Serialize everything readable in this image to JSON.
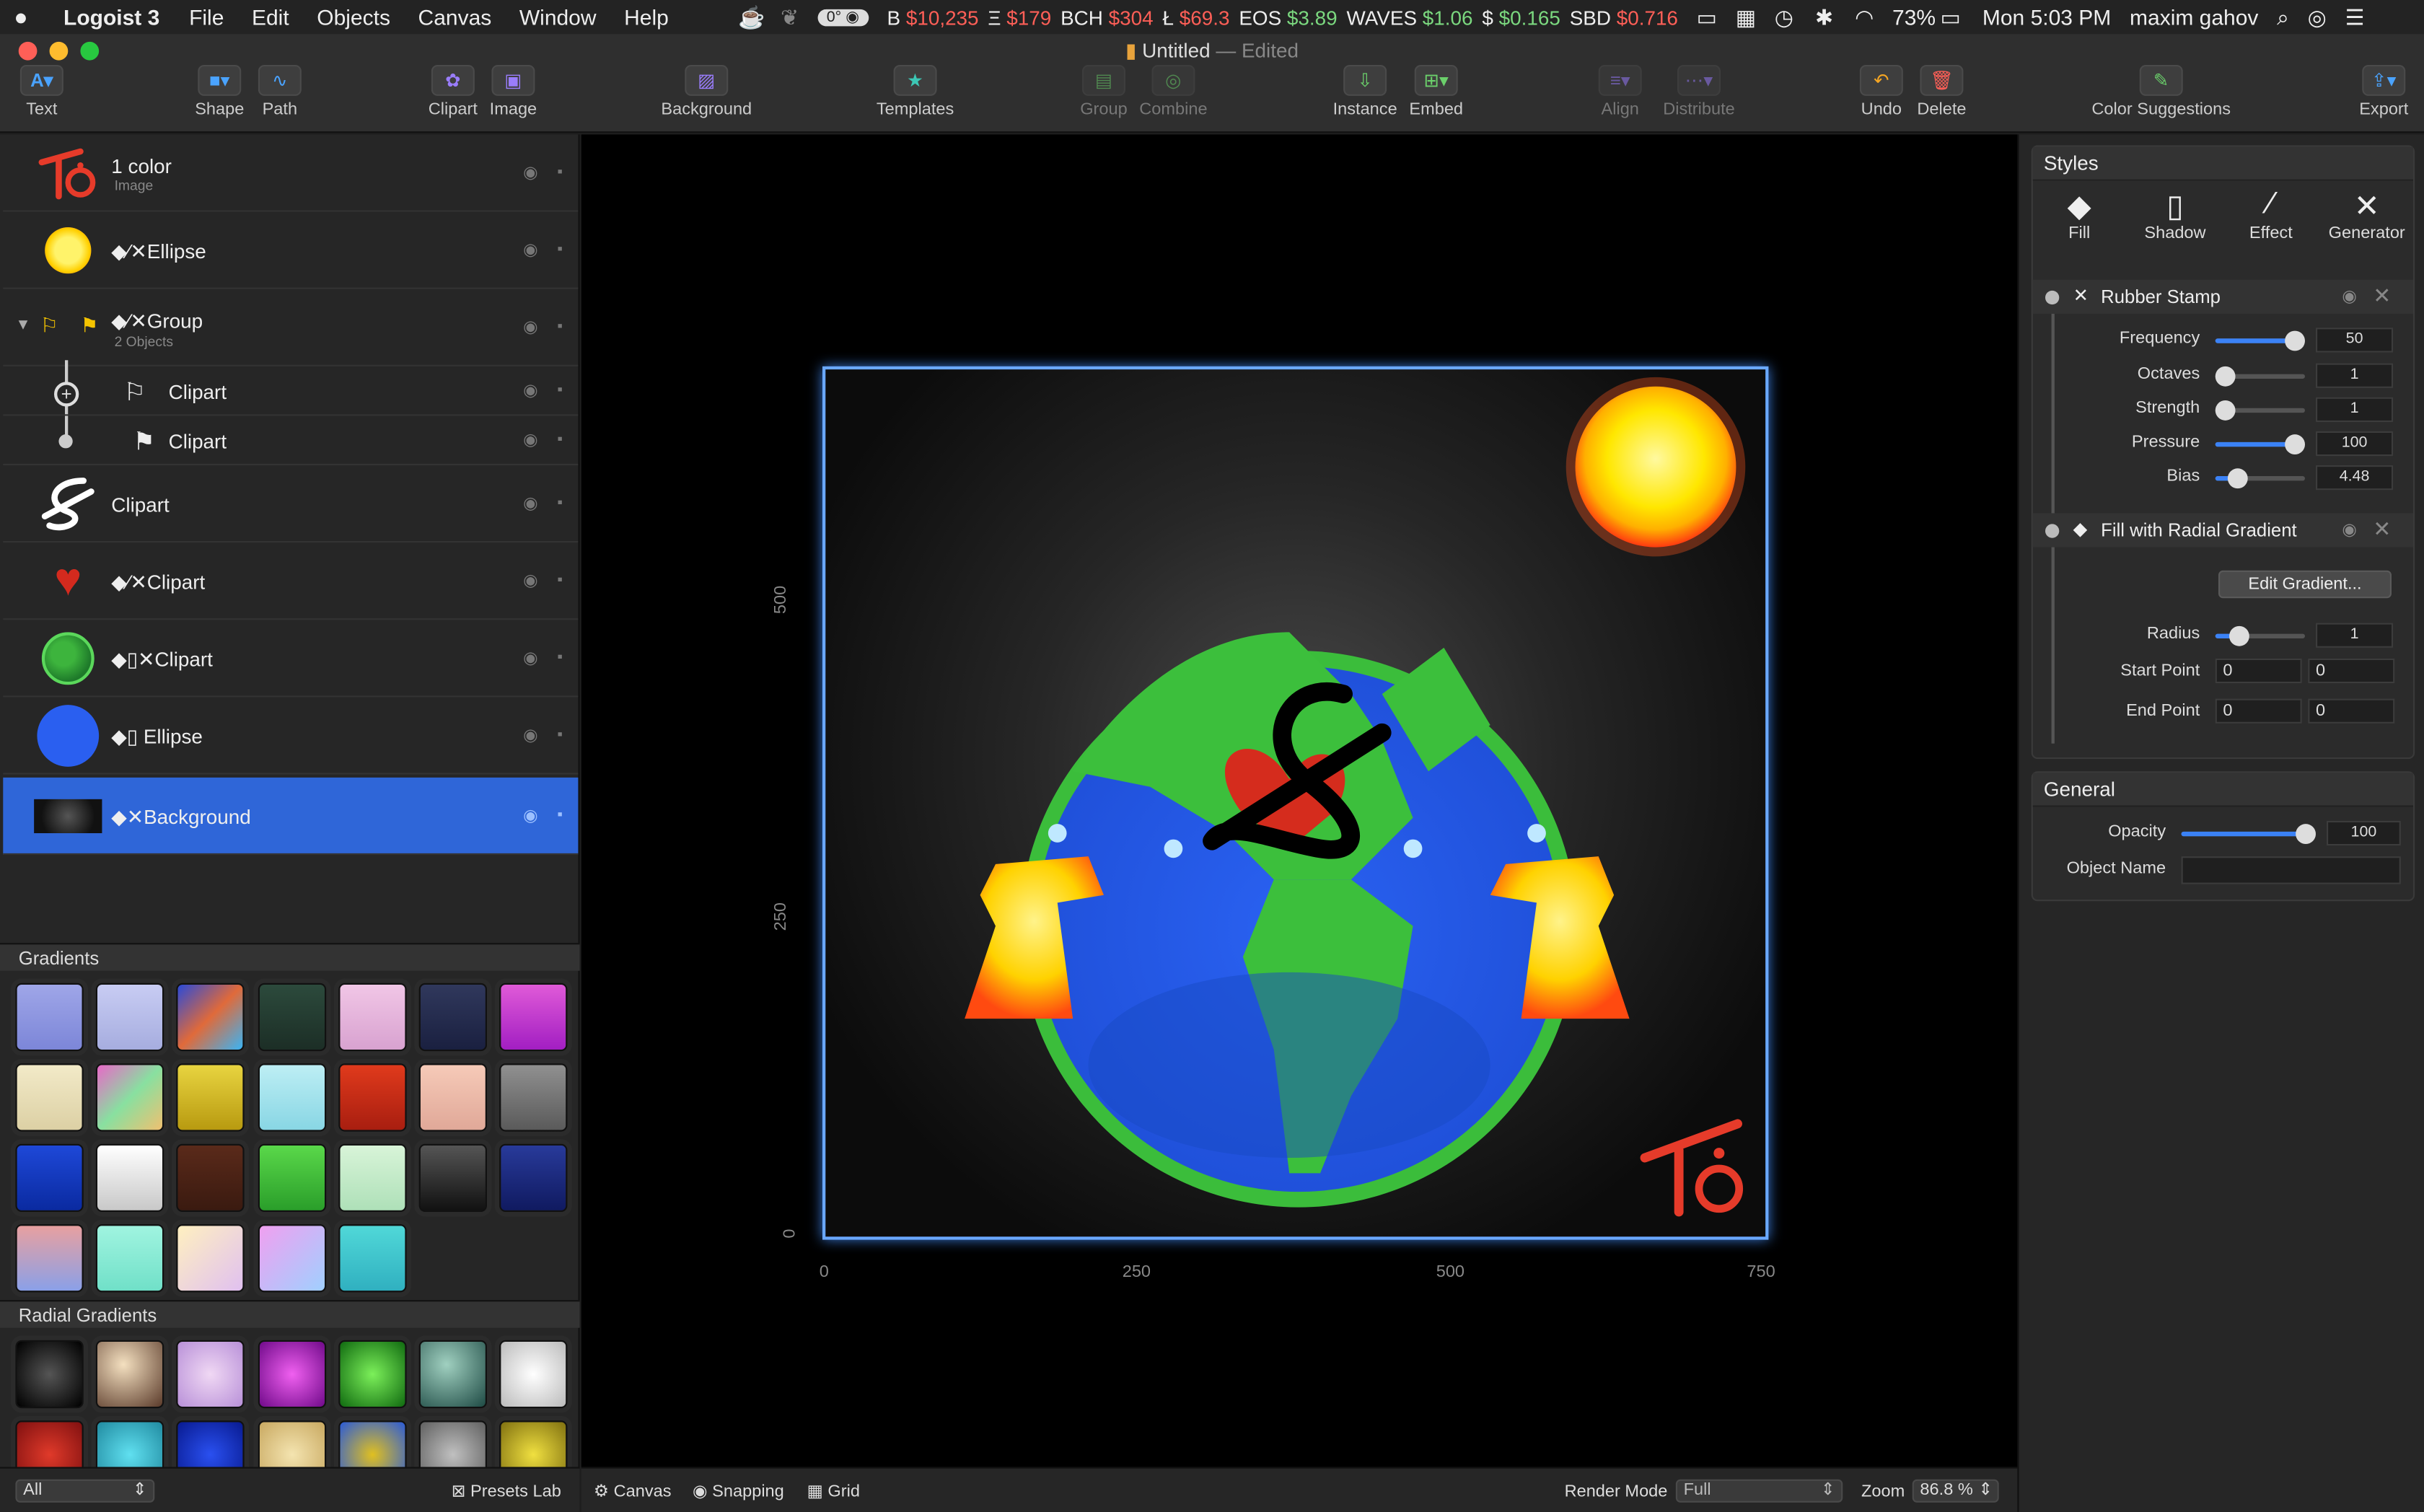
{
  "menubar": {
    "app": "Logoist 3",
    "menus": [
      "File",
      "Edit",
      "Objects",
      "Canvas",
      "Window",
      "Help"
    ],
    "temp": "0°",
    "tickers": [
      {
        "label": "B",
        "value": "$10,235",
        "c": "red"
      },
      {
        "label": "Ξ",
        "value": "$179",
        "c": "red"
      },
      {
        "label": "BCH",
        "value": "$304",
        "c": "red"
      },
      {
        "label": "Ł",
        "value": "$69.3",
        "c": "red"
      },
      {
        "label": "EOS",
        "value": "$3.89",
        "c": "grn"
      },
      {
        "label": "WAVES",
        "value": "$1.06",
        "c": "grn"
      },
      {
        "label": "$",
        "value": "$0.165",
        "c": "grn"
      },
      {
        "label": "SBD",
        "value": "$0.716",
        "c": "red"
      }
    ],
    "battery": "73%",
    "clock": "Mon 5:03 PM",
    "user": "maxim gahov"
  },
  "window": {
    "title": "Untitled",
    "edited": "— Edited"
  },
  "toolbar": {
    "text": "Text",
    "shape": "Shape",
    "path": "Path",
    "clipart": "Clipart",
    "image": "Image",
    "background": "Background",
    "templates": "Templates",
    "group": "Group",
    "combine": "Combine",
    "instance": "Instance",
    "embed": "Embed",
    "align": "Align",
    "distribute": "Distribute",
    "undo": "Undo",
    "delete": "Delete",
    "color_suggestions": "Color Suggestions",
    "export": "Export"
  },
  "layers": [
    {
      "name": "1 color",
      "sub": "Image"
    },
    {
      "name": "Ellipse"
    },
    {
      "name": "Group",
      "sub": "2 Objects"
    },
    {
      "name": "Clipart"
    },
    {
      "name": "Clipart"
    },
    {
      "name": "Clipart"
    },
    {
      "name": "Clipart"
    },
    {
      "name": "Clipart"
    },
    {
      "name": "Ellipse"
    },
    {
      "name": "Background"
    }
  ],
  "gradients": {
    "title": "Gradients",
    "radial_title": "Radial Gradients"
  },
  "left_bottom": {
    "filter": "All",
    "presets": "Presets Lab"
  },
  "canvas": {
    "y_ticks": [
      "500",
      "250",
      "0"
    ],
    "x_ticks": [
      "0",
      "250",
      "500",
      "750"
    ],
    "logo_text": "Tö"
  },
  "bottombar": {
    "canvas": "Canvas",
    "snapping": "Snapping",
    "grid": "Grid",
    "render_label": "Render Mode",
    "render_value": "Full",
    "zoom_label": "Zoom",
    "zoom_value": "86.8 %"
  },
  "styles": {
    "title": "Styles",
    "tabs": [
      "Fill",
      "Shadow",
      "Effect",
      "Generator"
    ],
    "rubber": {
      "title": "Rubber Stamp",
      "frequency_l": "Frequency",
      "frequency": "50",
      "octaves_l": "Octaves",
      "octaves": "1",
      "strength_l": "Strength",
      "strength": "1",
      "pressure_l": "Pressure",
      "pressure": "100",
      "bias_l": "Bias",
      "bias": "4.48"
    },
    "radial": {
      "title": "Fill with Radial Gradient",
      "edit": "Edit Gradient...",
      "radius_l": "Radius",
      "radius": "1",
      "start_l": "Start Point",
      "start_x": "0",
      "start_y": "0",
      "end_l": "End Point",
      "end_x": "0",
      "end_y": "0"
    }
  },
  "general": {
    "title": "General",
    "opacity_l": "Opacity",
    "opacity": "100",
    "name_l": "Object Name",
    "name": ""
  },
  "colors": {
    "accent": "#2f66d8",
    "slider": "#3b82f6",
    "bg": "#262626"
  }
}
